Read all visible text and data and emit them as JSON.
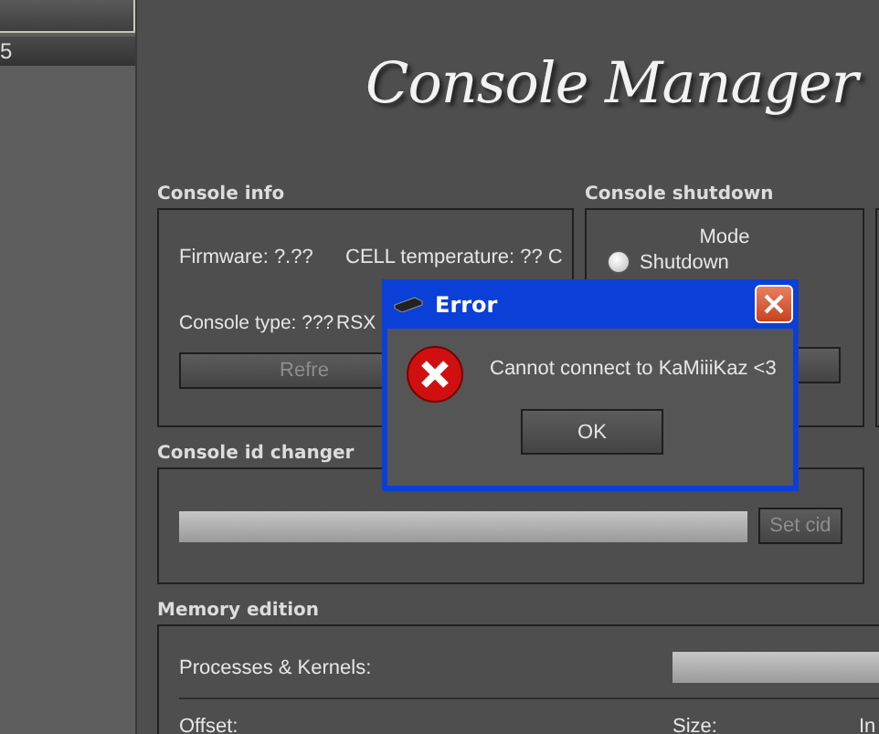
{
  "sidebar": {
    "items": [
      {
        "selected": false
      },
      {
        "label": "5",
        "selected": true
      }
    ]
  },
  "app_title": "Console Manager",
  "console_info": {
    "title": "Console info",
    "firmware": "Firmware: ?.??",
    "cell_temperature": "CELL temperature: ?? C",
    "console_type": "Console type: ???",
    "rsx": "RSX",
    "refresh_button": {
      "label": "Refre",
      "disabled": true
    }
  },
  "console_shutdown": {
    "title": "Console shutdown",
    "mode_label": "Mode",
    "options": [
      {
        "label": "Shutdown",
        "selected": false
      }
    ]
  },
  "console_id_changer": {
    "title": "Console id changer",
    "set_cid_button": {
      "label": "Set cid",
      "disabled": true
    }
  },
  "memory_edition": {
    "title": "Memory edition",
    "processes_label": "Processes & Kernels:",
    "offset_label": "Offset:",
    "size_label": "Size:",
    "column_3_label": "In"
  },
  "dialog": {
    "title": "Error",
    "message": "Cannot connect to KaMiiiKaz <3",
    "ok_button": "OK"
  }
}
